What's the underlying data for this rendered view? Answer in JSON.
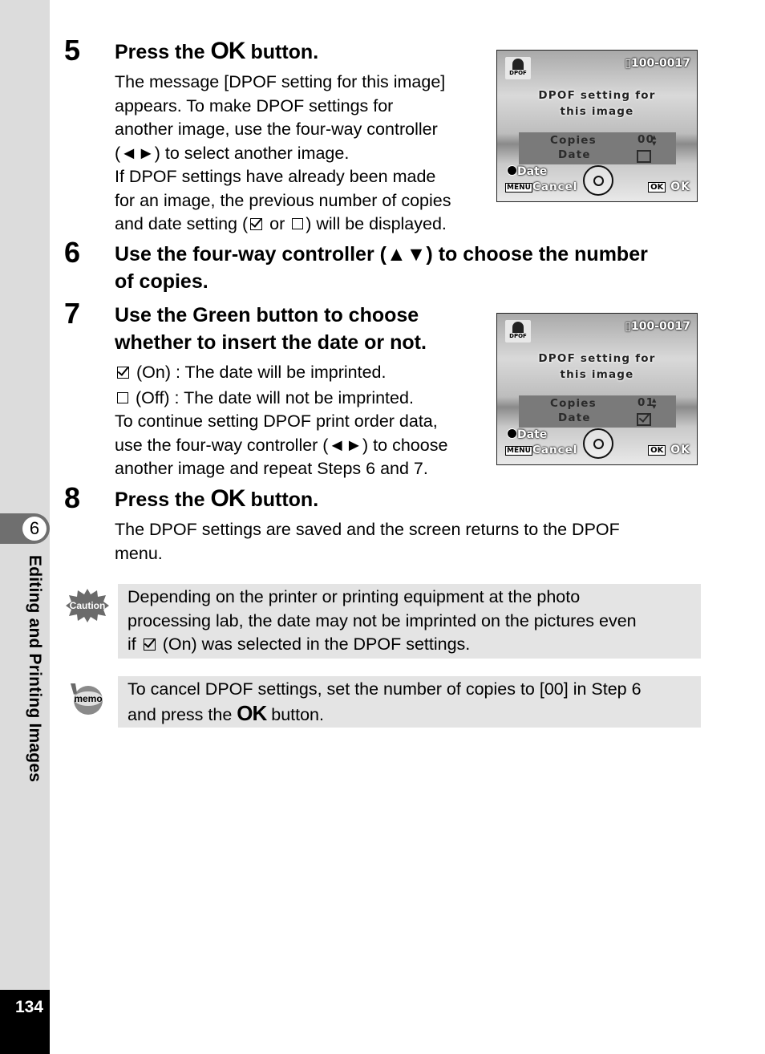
{
  "sidebar": {
    "chapter_number": "6",
    "chapter_title": "Editing and Printing Images",
    "page_number": "134"
  },
  "steps": [
    {
      "number": "5",
      "heading_pre": "Press the ",
      "heading_ok": "OK",
      "heading_post": " button.",
      "body": [
        "The message [DPOF setting for this image]",
        "appears. To make DPOF settings for",
        "another image, use the four-way controller",
        "(◄►) to select another image.",
        "If DPOF settings have already been made",
        "for an image, the previous number of copies"
      ],
      "body_last_pre": "and date setting (",
      "body_last_mid": " or ",
      "body_last_post": ") will be displayed."
    },
    {
      "number": "6",
      "heading_line1": "Use the four-way controller (▲▼) to choose the number",
      "heading_line2": "of copies."
    },
    {
      "number": "7",
      "heading_line1": "Use the Green button to choose",
      "heading_line2": "whether to insert the date or not.",
      "on_text": " (On) : The date will be imprinted.",
      "off_text": " (Off) : The date will not be imprinted.",
      "body": [
        "To continue setting DPOF print order data,",
        "use the four-way controller (◄►) to choose",
        "another image and repeat Steps 6 and 7."
      ]
    },
    {
      "number": "8",
      "heading_pre": "Press the ",
      "heading_ok": "OK",
      "heading_post": " button.",
      "body": [
        "The DPOF settings are saved and the screen returns to the DPOF",
        "menu."
      ]
    }
  ],
  "screens": [
    {
      "dpof_label": "DPOF",
      "file_number": "100-0017",
      "message_line1": "DPOF setting for",
      "message_line2": "this image",
      "copies_label": "Copies",
      "copies_value": "00",
      "date_label": "Date",
      "date_checked": false,
      "green_label": "Date",
      "menu_key": "MENU",
      "cancel_label": "Cancel",
      "ok_key": "OK",
      "ok_label": "OK"
    },
    {
      "dpof_label": "DPOF",
      "file_number": "100-0017",
      "message_line1": "DPOF setting for",
      "message_line2": "this image",
      "copies_label": "Copies",
      "copies_value": "01",
      "date_label": "Date",
      "date_checked": true,
      "green_label": "Date",
      "menu_key": "MENU",
      "cancel_label": "Cancel",
      "ok_key": "OK",
      "ok_label": "OK"
    }
  ],
  "caution": {
    "icon_label": "Caution",
    "line1": "Depending on the printer or printing equipment at the photo",
    "line2": "processing lab, the date may not be imprinted on the pictures even",
    "line3_pre": "if ",
    "line3_post": " (On) was selected in the DPOF settings."
  },
  "memo": {
    "icon_label": "memo",
    "line1": "To cancel DPOF settings, set the number of copies to [00] in Step 6",
    "line2_pre": "and press the ",
    "line2_ok": "OK",
    "line2_post": " button."
  }
}
